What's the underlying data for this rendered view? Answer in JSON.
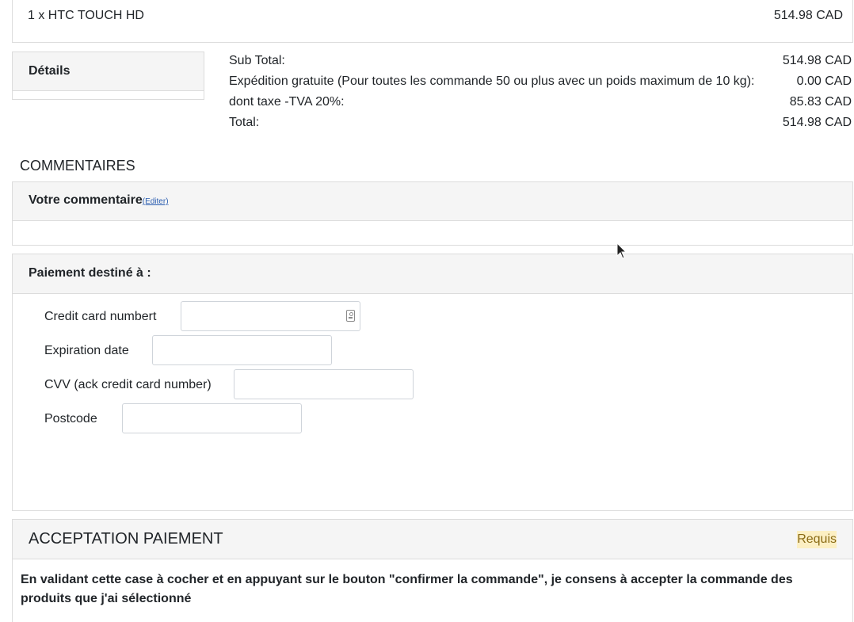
{
  "product_line": {
    "item": "1 x HTC TOUCH HD",
    "price": "514.98 CAD"
  },
  "details_tab": {
    "label": "Détails"
  },
  "totals": {
    "sub_total_label": "Sub Total:",
    "sub_total_value": "514.98 CAD",
    "shipping_label": "Expédition gratuite (Pour toutes les commande 50 ou plus avec un poids maximum de 10 kg):",
    "shipping_value": "0.00 CAD",
    "tax_label": "dont taxe -TVA 20%:",
    "tax_value": "85.83 CAD",
    "total_label": "Total:",
    "total_value": "514.98 CAD"
  },
  "comments": {
    "section_title": "COMMENTAIRES",
    "panel_title": "Votre commentaire",
    "edit_link": "(Editer)"
  },
  "payment": {
    "panel_title": "Paiement destiné à :",
    "fields": [
      {
        "label": "Credit card numbert",
        "value": ""
      },
      {
        "label": "Expiration date",
        "value": ""
      },
      {
        "label": "CVV (ack credit card number)",
        "value": ""
      },
      {
        "label": "Postcode",
        "value": ""
      }
    ]
  },
  "acceptance": {
    "title": "ACCEPTATION PAIEMENT",
    "badge": "Requis",
    "text": "En validant cette case à cocher et en appuyant sur le bouton \"confirmer la commande\", je consens à accepter la commande des produits que j'ai sélectionné"
  },
  "icons": {
    "card_field_icon": "contact-card-icon",
    "cursor": "mouse-pointer-icon"
  },
  "colors": {
    "link": "#2a5db0",
    "badge_bg": "#fcefc3",
    "badge_text": "#8a6b16"
  }
}
